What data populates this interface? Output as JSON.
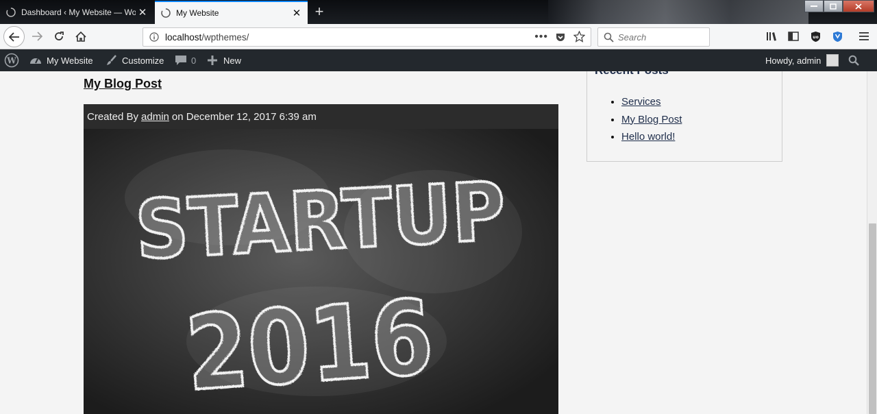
{
  "browser": {
    "tabs": [
      {
        "title": "Dashboard ‹ My Website — Wo",
        "active": false
      },
      {
        "title": "My Website",
        "active": true
      }
    ],
    "new_tab_symbol": "+",
    "url_host": "localhost",
    "url_path": "/wpthemes/",
    "search_placeholder": "Search",
    "accent": "#0a84ff"
  },
  "adminbar": {
    "site_name": "My Website",
    "customize": "Customize",
    "comments_count": "0",
    "new_label": "New",
    "greeting": "Howdy, admin",
    "background": "#23282d"
  },
  "post": {
    "title": "My Blog Post",
    "meta_prefix": "Created By",
    "author": "admin",
    "meta_suffix": "on December 12, 2017 6:39 am",
    "image_text_line1": "STARTUP",
    "image_text_line2": "2016"
  },
  "sidebar": {
    "heading": "Recent Posts",
    "items": [
      {
        "label": "Services"
      },
      {
        "label": "My Blog Post"
      },
      {
        "label": "Hello world!"
      }
    ]
  }
}
